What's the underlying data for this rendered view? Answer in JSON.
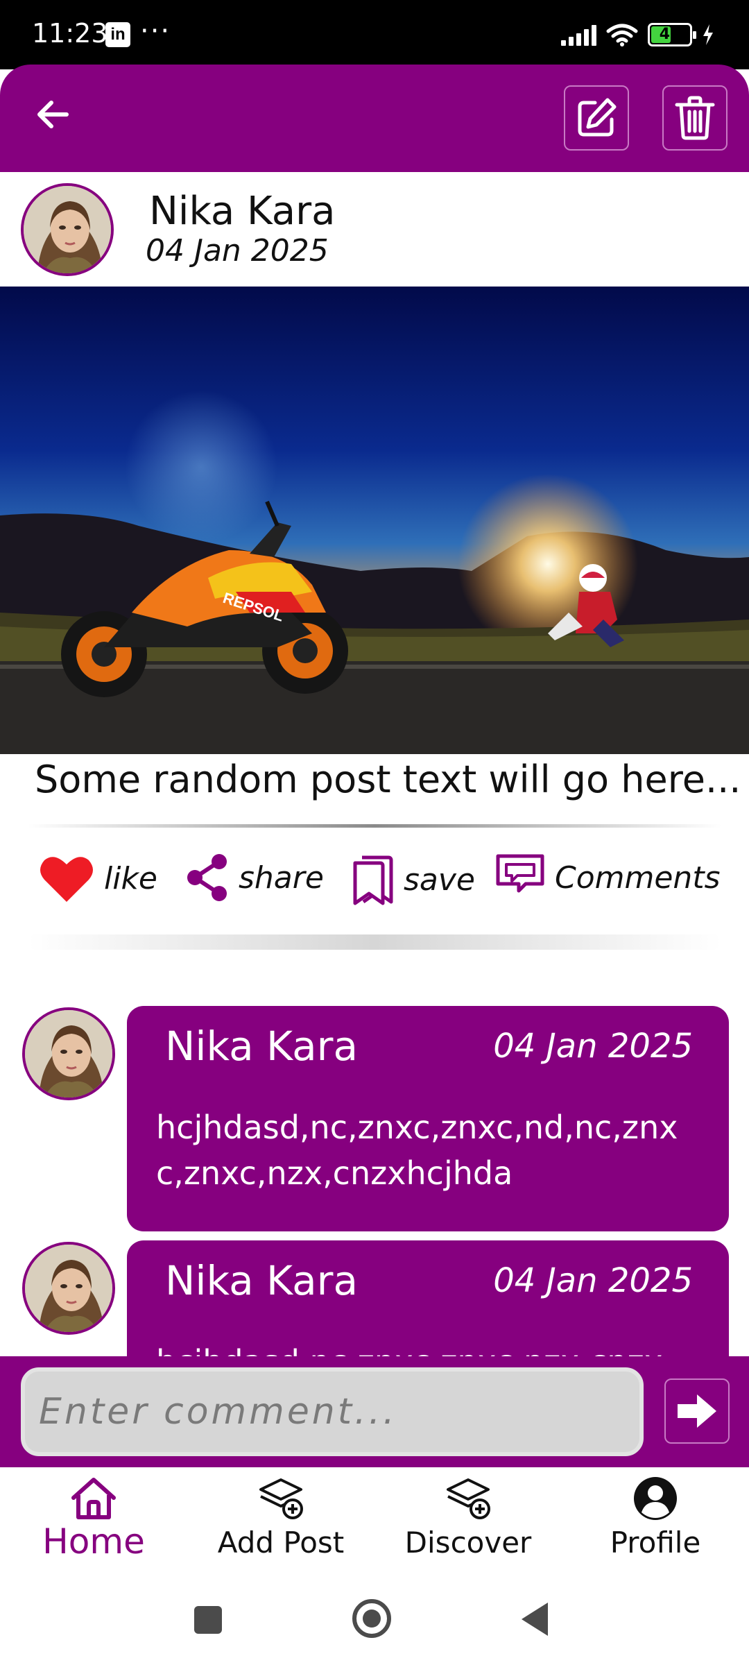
{
  "status_bar": {
    "time": "11:23",
    "app_icon": "in",
    "more": "···",
    "battery": "48",
    "battery_level": 0.48
  },
  "app_bar": {
    "back_icon": "arrow-left-icon",
    "edit_icon": "edit-icon",
    "delete_icon": "trash-icon"
  },
  "post": {
    "author_name": "Nika Kara",
    "date": "04 Jan 2025",
    "text": "Some random post text will go here...",
    "image_description_icon": "photo-icon"
  },
  "actions": {
    "like": "like",
    "share": "share",
    "save": "save",
    "comments": "Comments"
  },
  "comments": [
    {
      "name": "Nika Kara",
      "date": "04 Jan 2025",
      "text": "hcjhdasd,nc,znxc,znxc,nd,nc,znxc,znxc,nzx,cnzxhcjhda"
    },
    {
      "name": "Nika Kara",
      "date": "04 Jan 2025",
      "text": "hcjhdasd,nc,znxc,znxc,nzx,cnzx"
    }
  ],
  "comment_input": {
    "placeholder": "Enter comment..."
  },
  "bottom_nav": {
    "home": "Home",
    "add_post": "Add Post",
    "discover": "Discover",
    "profile": "Profile"
  },
  "colors": {
    "primary": "#86007f",
    "like": "#ee1c25"
  }
}
